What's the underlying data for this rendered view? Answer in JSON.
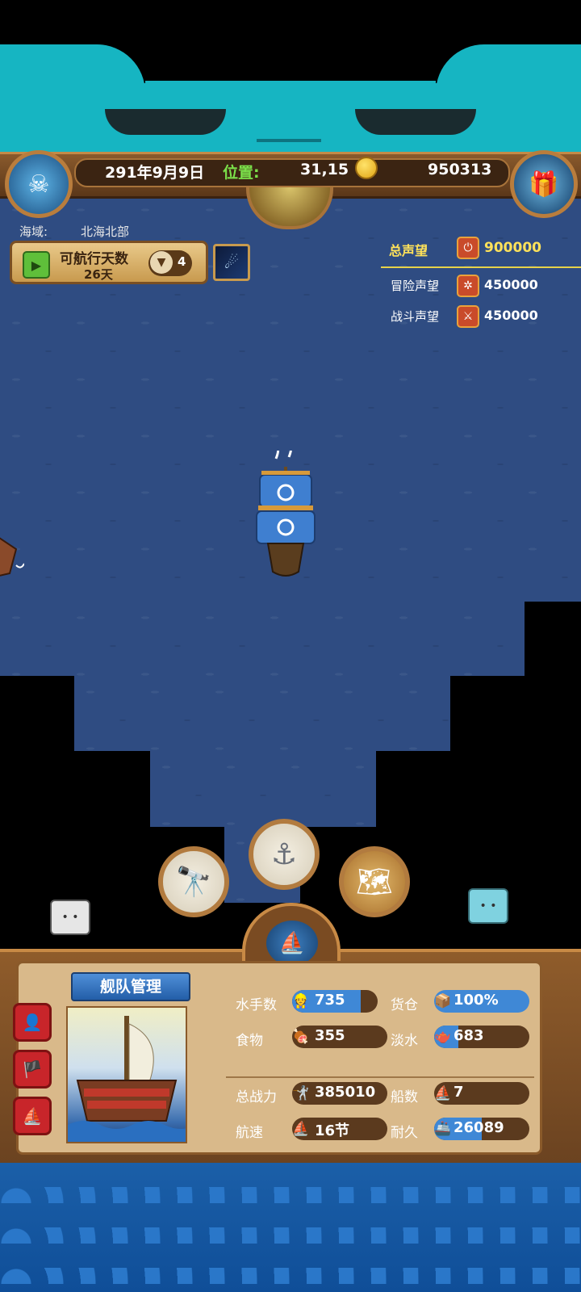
{
  "header": {
    "date": "291年9月9日",
    "position_label": "位置:",
    "position_value": "31,15",
    "gold": "950313"
  },
  "region": {
    "label": "海域:",
    "value": "北海北部"
  },
  "sailing": {
    "title": "可航行天数",
    "days": "26天",
    "speed_count": "4"
  },
  "reputation": {
    "total_label": "总声望",
    "total_value": "900000",
    "items": [
      {
        "label": "冒险声望",
        "value": "450000",
        "icon": "ship-wheel-icon"
      },
      {
        "label": "战斗声望",
        "value": "450000",
        "icon": "crossed-swords-icon"
      }
    ]
  },
  "fleet": {
    "title": "舰队管理",
    "stats": {
      "sailors_label": "水手数",
      "sailors_value": "735",
      "sailors_fill": 0.8,
      "cargo_label": "货仓",
      "cargo_value": "100%",
      "cargo_fill": 1.0,
      "food_label": "食物",
      "food_value": "355",
      "food_fill": 0.0,
      "water_label": "淡水",
      "water_value": "683",
      "water_fill": 0.25,
      "power_label": "总战力",
      "power_value": "385010",
      "power_fill": 0.0,
      "ships_label": "船数",
      "ships_value": "7",
      "ships_fill": 0.0,
      "speed_label": "航速",
      "speed_value": "16节",
      "speed_fill": 0.0,
      "durability_label": "耐久",
      "durability_value": "26089",
      "durability_fill": 0.5
    }
  },
  "colors": {
    "sea": "#2f4c82",
    "cat": "#16b5c2",
    "gold_text": "#ffe25a",
    "pos_label": "#7be04a",
    "panel_wood": "#8f5c2b",
    "parchment": "#d9b98a"
  },
  "icons": [
    "telescope-icon",
    "anchor-icon",
    "map-icon",
    "compass-ship-icon",
    "gold-coin-icon",
    "treasure-chest-icon",
    "play-icon",
    "down-arrow-icon",
    "comet-icon"
  ]
}
